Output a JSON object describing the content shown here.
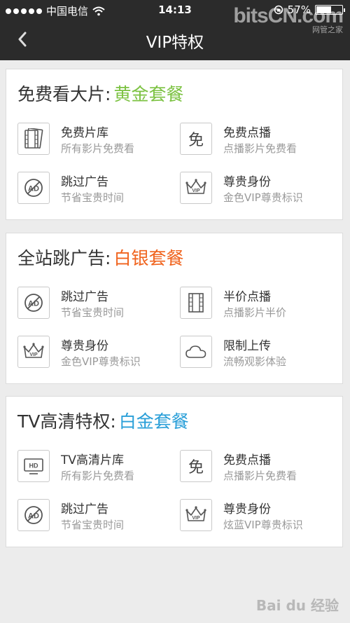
{
  "status_bar": {
    "carrier": "中国电信",
    "time": "14:13",
    "battery": "57%",
    "battery_level": 0.57
  },
  "watermark": {
    "brand": "bitsCN.com",
    "sub": "网管之家"
  },
  "nav": {
    "title": "VIP特权"
  },
  "colors": {
    "gold": "#7cc242",
    "silver": "#f0631d",
    "platinum": "#2a9fd8"
  },
  "sections": [
    {
      "title": "免费看大片:",
      "highlight": "黄金套餐",
      "features": [
        {
          "icon": "film-library-icon",
          "title": "免费片库",
          "subtitle": "所有影片免费看"
        },
        {
          "icon": "free-icon",
          "glyph": "免",
          "title": "免费点播",
          "subtitle": "点播影片免费看"
        },
        {
          "icon": "ad-skip-icon",
          "title": "跳过广告",
          "subtitle": "节省宝贵时间"
        },
        {
          "icon": "vip-crown-icon",
          "title": "尊贵身份",
          "subtitle": "金色VIP尊贵标识"
        }
      ]
    },
    {
      "title": "全站跳广告:",
      "highlight": "白银套餐",
      "features": [
        {
          "icon": "ad-skip-icon",
          "title": "跳过广告",
          "subtitle": "节省宝贵时间"
        },
        {
          "icon": "film-strip-icon",
          "title": "半价点播",
          "subtitle": "点播影片半价"
        },
        {
          "icon": "vip-crown-icon",
          "title": "尊贵身份",
          "subtitle": "金色VIP尊贵标识"
        },
        {
          "icon": "cloud-icon",
          "title": "限制上传",
          "subtitle": "流畅观影体验"
        }
      ]
    },
    {
      "title": "TV高清特权:",
      "highlight": "白金套餐",
      "features": [
        {
          "icon": "hd-tv-icon",
          "title": "TV高清片库",
          "subtitle": "所有影片免费看"
        },
        {
          "icon": "free-icon",
          "glyph": "免",
          "title": "免费点播",
          "subtitle": "点播影片免费看"
        },
        {
          "icon": "ad-skip-icon",
          "title": "跳过广告",
          "subtitle": "节省宝贵时间"
        },
        {
          "icon": "vip-crown-icon",
          "title": "尊贵身份",
          "subtitle": "炫蓝VIP尊贵标识"
        }
      ]
    }
  ],
  "bottom_watermark": "Bai du 经验"
}
